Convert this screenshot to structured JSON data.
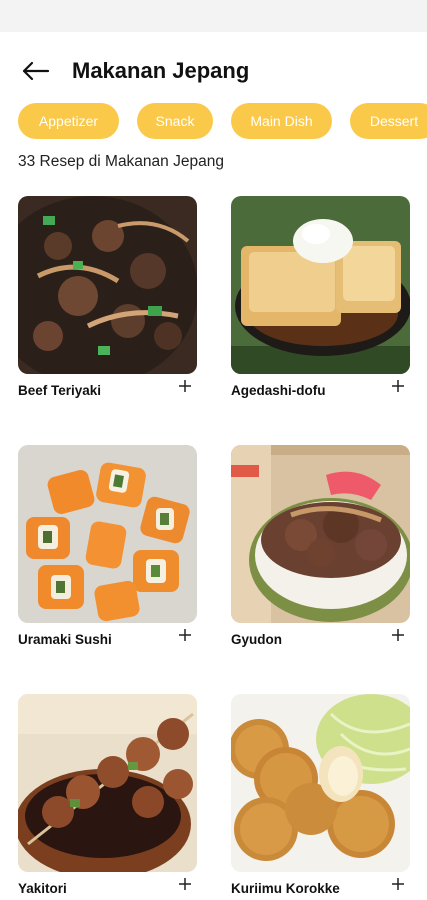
{
  "header": {
    "title": "Makanan Jepang",
    "back_icon": "arrow-left-icon"
  },
  "categories": [
    {
      "label": "Appetizer"
    },
    {
      "label": "Snack"
    },
    {
      "label": "Main Dish"
    },
    {
      "label": "Dessert"
    }
  ],
  "recipe_count_text": "33 Resep di Makanan Jepang",
  "recipes": [
    {
      "name": "Beef Teriyaki",
      "add_icon": "plus-icon"
    },
    {
      "name": "Agedashi-dofu",
      "add_icon": "plus-icon"
    },
    {
      "name": "Uramaki Sushi",
      "add_icon": "plus-icon"
    },
    {
      "name": "Gyudon",
      "add_icon": "plus-icon"
    },
    {
      "name": "Yakitori",
      "add_icon": "plus-icon"
    },
    {
      "name": "Kuriimu Korokke",
      "add_icon": "plus-icon"
    }
  ],
  "colors": {
    "chip": "#fbc94a",
    "chip_text": "#ffffff"
  }
}
